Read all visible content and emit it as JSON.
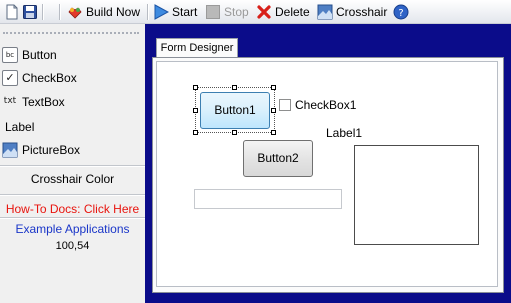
{
  "toolbar": {
    "icons": [
      "new-document-icon",
      "save-icon",
      "build-icon",
      "start-icon",
      "stop-icon",
      "delete-icon",
      "crosshair-icon",
      "help-icon"
    ],
    "build_label": "Build Now",
    "start_label": "Start",
    "stop_label": "Stop",
    "delete_label": "Delete",
    "crosshair_label": "Crosshair"
  },
  "toolbox": {
    "items": [
      {
        "label": "Button",
        "icon_text": "bc",
        "icon": "button-control-icon"
      },
      {
        "label": "CheckBox",
        "icon_text": "✓",
        "icon": "checkbox-control-icon"
      },
      {
        "label": "TextBox",
        "icon_text": "txt",
        "icon": "textbox-control-icon"
      },
      {
        "label": "Label",
        "icon_text": "",
        "icon": ""
      },
      {
        "label": "PictureBox",
        "icon_text": "",
        "icon": "picturebox-control-icon"
      }
    ],
    "crosshair_color_label": "Crosshair Color",
    "howto_link": "How-To Docs: Click Here",
    "examples_link": "Example Applications",
    "coords": "100,54"
  },
  "designer": {
    "tab_label": "Form Designer",
    "button1": "Button1",
    "button2": "Button2",
    "checkbox1": "CheckBox1",
    "label1": "Label1"
  },
  "colors": {
    "designer_background": "#0b0c8a",
    "link_red": "#e8140e",
    "link_blue": "#1a36c8"
  }
}
